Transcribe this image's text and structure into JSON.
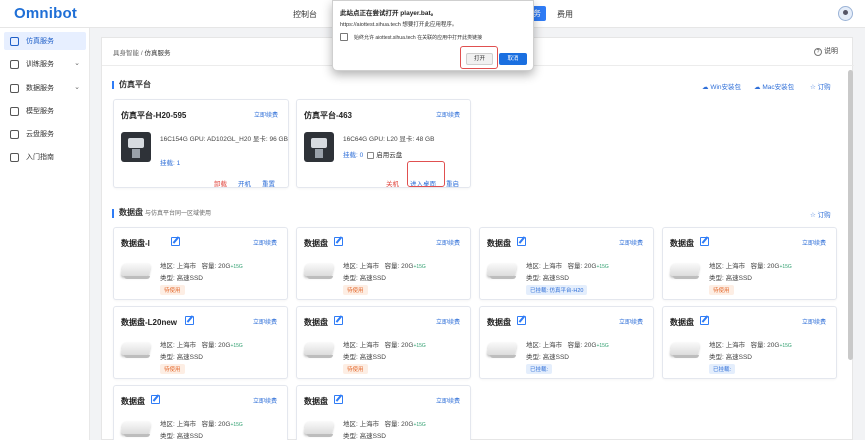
{
  "header": {
    "logo": "Omnibot",
    "nav": [
      {
        "label": "控制台"
      },
      {
        "label": "务"
      },
      {
        "label": "费用"
      }
    ]
  },
  "sidebar": {
    "items": [
      {
        "label": "仿真服务",
        "icon": "simulation-icon",
        "active": true
      },
      {
        "label": "训练服务",
        "icon": "training-icon",
        "expandable": true
      },
      {
        "label": "数据服务",
        "icon": "data-icon",
        "expandable": true
      },
      {
        "label": "模型服务",
        "icon": "model-icon"
      },
      {
        "label": "云盘服务",
        "icon": "cloud-disk-icon"
      },
      {
        "label": "入门指南",
        "icon": "guide-icon"
      }
    ]
  },
  "breadcrumb": {
    "root": "具身智能",
    "sep": "/",
    "current": "仿真服务"
  },
  "help": {
    "label": "说明"
  },
  "platform_section": {
    "title": "仿真平台",
    "links": {
      "win": "Win安装包",
      "mac": "Mac安装包",
      "order": "订购"
    },
    "cards": [
      {
        "title": "仿真平台-H20-595",
        "renew": "立即续费",
        "spec": "16C154G   GPU:  AD102GL_H20    显卡:  96 GB",
        "mount": "挂载: 1",
        "actions": [
          "卸载",
          "开机",
          "重置"
        ]
      },
      {
        "title": "仿真平台-463",
        "renew": "立即续费",
        "spec": "16C64G   GPU:  L20   显卡:  48 GB",
        "mount": "挂载: 0",
        "cloud_option": "启用云盘",
        "actions": [
          "关机",
          "进入桌面",
          "重启"
        ]
      }
    ]
  },
  "disk_section": {
    "title": "数据盘",
    "subtitle": "与仿真平台同一区域使用",
    "order": "订购",
    "cards": [
      {
        "title": "数据盘-l",
        "renew": "立即续费",
        "region": "地区: 上海市",
        "capacity": "容量:  20G",
        "plus": "+15G",
        "type": "类型: 高速SSD",
        "status": "待使用",
        "status_kind": "unused"
      },
      {
        "title": "数据盘",
        "renew": "立即续费",
        "region": "地区: 上海市",
        "capacity": "容量:  20G",
        "plus": "+15G",
        "type": "类型: 高速SSD",
        "status": "待使用",
        "status_kind": "unused"
      },
      {
        "title": "数据盘",
        "renew": "立即续费",
        "region": "地区: 上海市",
        "capacity": "容量:  20G",
        "plus": "+15G",
        "type": "类型: 高速SSD",
        "status": "已挂载: 仿真平台-H20",
        "status_kind": "mounted"
      },
      {
        "title": "数据盘",
        "renew": "立即续费",
        "region": "地区: 上海市",
        "capacity": "容量:  20G",
        "plus": "+15G",
        "type": "类型: 高速SSD",
        "status": "待使用",
        "status_kind": "unused"
      },
      {
        "title": "数据盘-L20new",
        "renew": "立即续费",
        "region": "地区: 上海市",
        "capacity": "容量:  20G",
        "plus": "+15G",
        "type": "类型: 高速SSD",
        "status": "待使用",
        "status_kind": "unused"
      },
      {
        "title": "数据盘",
        "renew": "立即续费",
        "region": "地区: 上海市",
        "capacity": "容量:  20G",
        "plus": "+15G",
        "type": "类型: 高速SSD",
        "status": "待使用",
        "status_kind": "unused"
      },
      {
        "title": "数据盘",
        "renew": "立即续费",
        "region": "地区: 上海市",
        "capacity": "容量:  20G",
        "plus": "+15G",
        "type": "类型: 高速SSD",
        "status": "已挂载:",
        "status_kind": "mounted"
      },
      {
        "title": "数据盘",
        "renew": "立即续费",
        "region": "地区: 上海市",
        "capacity": "容量:  20G",
        "plus": "+15G",
        "type": "类型: 高速SSD",
        "status": "已挂载:",
        "status_kind": "mounted"
      },
      {
        "title": "数据盘",
        "renew": "立即续费",
        "region": "地区: 上海市",
        "capacity": "容量:  20G",
        "plus": "+15G",
        "type": "类型: 高速SSD"
      },
      {
        "title": "数据盘",
        "renew": "立即续费",
        "region": "地区: 上海市",
        "capacity": "容量:  20G",
        "plus": "+15G",
        "type": "类型: 高速SSD"
      }
    ]
  },
  "dialog": {
    "title": "此站点正在尝试打开 player.bat。",
    "message": "https://aiottest.sihua.tech 想要打开此应用程序。",
    "checkbox_label": "始终允许 aiottest.sihua.tech 在关联的应用中打开此类链接",
    "open": "打开",
    "cancel": "取消"
  },
  "colors": {
    "accent": "#2f7cf6",
    "danger": "#e0433b",
    "link": "#2f6fd8"
  }
}
